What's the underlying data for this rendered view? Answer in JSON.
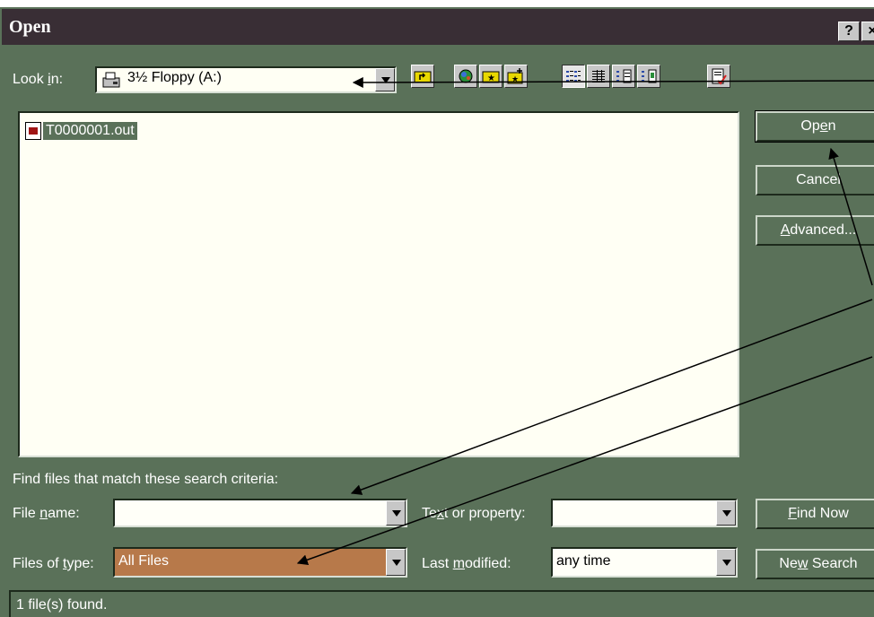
{
  "window": {
    "title": "Open",
    "help_button": "?",
    "close_button": "×"
  },
  "look_in": {
    "label_pre": "Look ",
    "label_accel": "i",
    "label_post": "n:",
    "value": "3½ Floppy (A:)",
    "icon": "floppy-drive-icon"
  },
  "toolbar": {
    "icons": [
      "up-one-level-icon",
      "search-web-icon",
      "look-in-favorites-icon",
      "add-to-favorites-icon",
      "list-view-icon",
      "details-view-icon",
      "properties-view-icon",
      "preview-view-icon",
      "commands-and-settings-icon"
    ]
  },
  "file_list": {
    "items": [
      {
        "name": "T0000001.out",
        "icon": "out-file-icon",
        "selected": true
      }
    ]
  },
  "buttons": {
    "open_pre": "Op",
    "open_accel": "e",
    "open_post": "n",
    "cancel": "Cancel",
    "advanced_accel": "A",
    "advanced_post": "dvanced...",
    "find_now_accel": "F",
    "find_now_post": "ind Now",
    "new_search_pre": "Ne",
    "new_search_accel": "w",
    "new_search_post": " Search"
  },
  "search": {
    "heading": "Find files that match these search criteria:",
    "file_name_pre": "File ",
    "file_name_accel": "n",
    "file_name_post": "ame:",
    "file_name_value": "",
    "files_of_type_pre": "Files of ",
    "files_of_type_accel": "t",
    "files_of_type_post": "ype:",
    "files_of_type_value": "All Files",
    "text_prop_pre": "Te",
    "text_prop_accel": "x",
    "text_prop_post": "t or property:",
    "text_prop_value": "",
    "last_mod_pre": "Last ",
    "last_mod_accel": "m",
    "last_mod_post": "odified:",
    "last_mod_value": "any time"
  },
  "status": {
    "text": "1 file(s) found."
  },
  "colors": {
    "dialog_bg": "#5a7159",
    "title_bg": "#392e35",
    "files_of_type_highlight": "#b7794a",
    "annotation_arrow": "#000000"
  }
}
